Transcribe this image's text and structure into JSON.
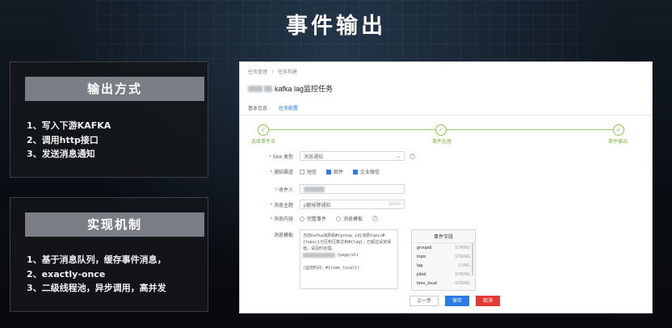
{
  "slide": {
    "title": "事件输出"
  },
  "left_panels": [
    {
      "heading": "输出方式",
      "items": [
        "1、写入下游KAFKA",
        "2、调用http接口",
        "3、发送消息通知"
      ]
    },
    {
      "heading": "实现机制",
      "items": [
        "1、基于消息队列，缓存事件消息，",
        "2、exactly-once",
        "3、二级线程池，异步调用，高并发"
      ]
    }
  ],
  "screenshot": {
    "breadcrumb": [
      "任务管理",
      "/",
      "任务构建"
    ],
    "task_title": "kafka lag监控任务",
    "tabs": [
      "基本信息",
      "任务配置"
    ],
    "active_tab": "任务配置",
    "steps": [
      "选择事件流",
      "事件处理",
      "事件输出"
    ],
    "form": {
      "sink_label": "Sink 类型",
      "sink_value": "消息通知",
      "channel_label": "通知渠道",
      "channels": [
        {
          "label": "短信",
          "checked": false
        },
        {
          "label": "邮件",
          "checked": true
        },
        {
          "label": "企业微信",
          "checked": true
        }
      ],
      "receiver_label": "收件人",
      "subject_label": "消息主题",
      "subject_value": "p额报警通知",
      "subject_count": "10/100",
      "content_label": "消息内容",
      "content_options": [
        "完整事件",
        "消息模板"
      ],
      "template_label": "消息模板",
      "template_lines": [
        "当前kafka消费组#{group_id}消费topic#",
        "{topic}分区积压数达到#{lag}，已超过设定阈",
        "值，请及时处理。",
        "                  /page/ali",
        "",
        "(监控时间：#{time_local})"
      ]
    },
    "event_fields": {
      "title": "事件字段",
      "rows": [
        {
          "name": "groupid",
          "type": "STRING"
        },
        {
          "name": "topic",
          "type": "STRING"
        },
        {
          "name": "lag",
          "type": "LONG"
        },
        {
          "name": "jobid",
          "type": "STRING"
        },
        {
          "name": "time_local",
          "type": "STRING"
        }
      ]
    },
    "buttons": {
      "prev": "上一步",
      "save": "保存",
      "cancel": "取消"
    }
  }
}
